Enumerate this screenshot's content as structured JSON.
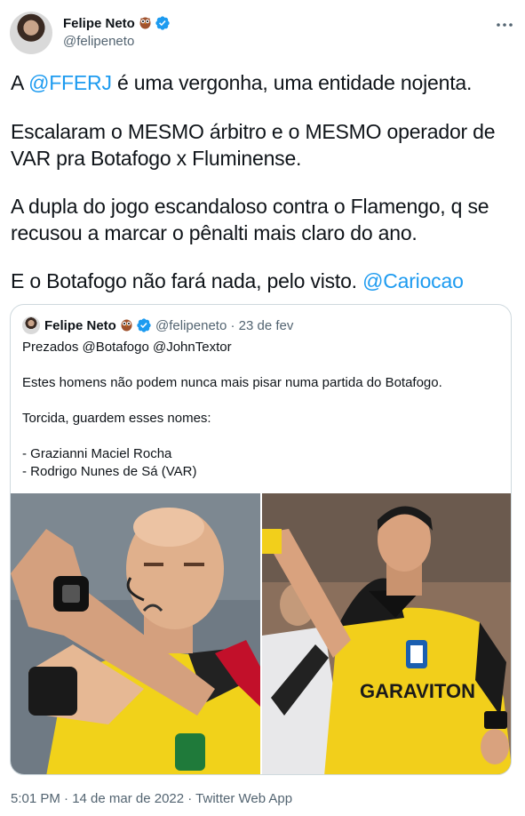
{
  "tweet": {
    "author": {
      "name": "Felipe Neto",
      "handle": "@felipeneto"
    },
    "text_lines": [
      {
        "pre": "A ",
        "mention": "@FFERJ",
        "post": " é uma vergonha, uma entidade nojenta."
      },
      {
        "pre": "Escalaram o MESMO árbitro e o MESMO operador de"
      },
      {
        "pre": "VAR pra Botafogo x Fluminense."
      },
      {
        "pre": "A dupla do jogo escandaloso contra o Flamengo, q se"
      },
      {
        "pre": "recusou a marcar o pênalti mais claro do ano."
      },
      {
        "pre": "E o Botafogo não fará nada, pelo visto. ",
        "mention": "@Cariocao"
      }
    ],
    "timestamp": "5:01 PM · 14 de mar de 2022 · Twitter Web App",
    "colors": {
      "accent": "#1d9bf0",
      "text": "#0f1419",
      "secondary": "#536471",
      "border": "#cfd9de"
    }
  },
  "quote": {
    "name": "Felipe Neto",
    "handle": "@felipeneto",
    "date": "· 23 de fev",
    "lines": [
      "Prezados @Botafogo @JohnTextor",
      "Estes homens não podem nunca mais pisar numa partida do Botafogo.",
      "Torcida, guardem esses nomes:",
      "- Grazianni Maciel Rocha",
      "- Rodrigo Nunes de Sá (VAR)"
    ],
    "photo_right_sponsor": "GARAVITON"
  }
}
